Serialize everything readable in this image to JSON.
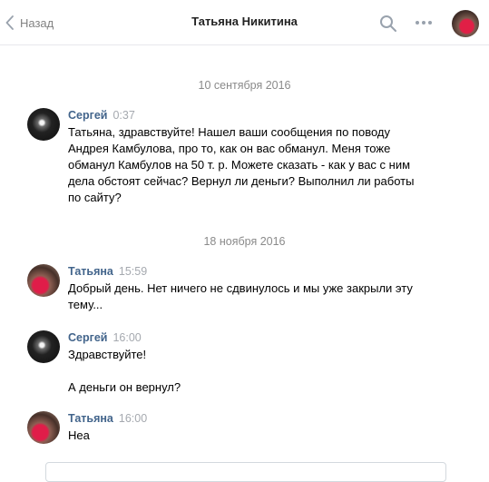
{
  "header": {
    "back_label": "Назад",
    "title": "Татьяна Никитина"
  },
  "dates": [
    "10 сентября 2016",
    "18 ноября 2016"
  ],
  "messages": [
    {
      "author": "Сергей",
      "time": "0:37",
      "lines": [
        "Татьяна, здравствуйте! Нашел ваши сообщения по поводу",
        "Андрея Камбулова, про то, как он вас обманул. Меня тоже",
        "обманул Камбулов на 50 т. р. Можете сказать - как у вас с ним",
        "дела обстоят сейчас? Вернул ли деньги? Выполнил ли работы",
        "по сайту?"
      ]
    },
    {
      "author": "Татьяна",
      "time": "15:59",
      "lines": [
        "Добрый день. Нет ничего не сдвинулось и мы уже закрыли эту",
        "тему..."
      ]
    },
    {
      "author": "Сергей",
      "time": "16:00",
      "text1": "Здравствуйте!",
      "text2": "А деньги он вернул?"
    },
    {
      "author": "Татьяна",
      "time": "16:00",
      "text": "Неа"
    }
  ]
}
